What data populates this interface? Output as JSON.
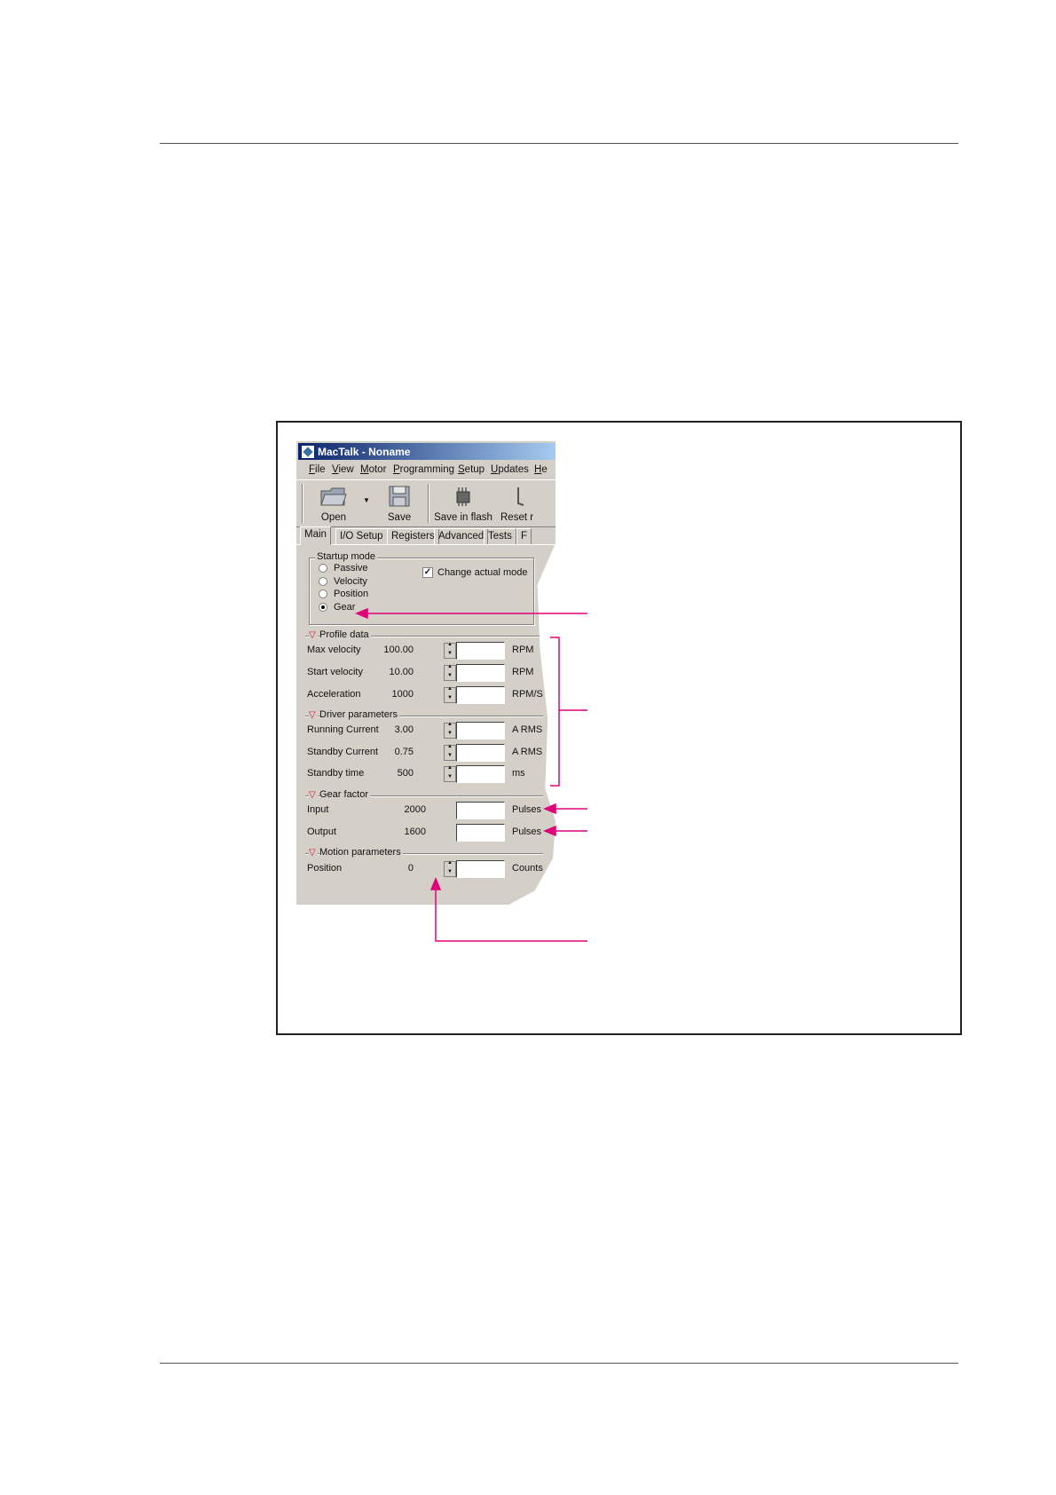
{
  "window": {
    "title": "MacTalk - Noname"
  },
  "menu": [
    "File",
    "View",
    "Motor",
    "Programming",
    "Setup",
    "Updates",
    "He"
  ],
  "toolbar": {
    "open": "Open",
    "save": "Save",
    "save_flash": "Save in flash",
    "reset": "Reset r"
  },
  "tabs": [
    "Main",
    "I/O Setup",
    "Registers",
    "Advanced",
    "Tests",
    "F"
  ],
  "startup_mode": {
    "title": "Startup mode",
    "options": [
      "Passive",
      "Velocity",
      "Position",
      "Gear"
    ],
    "selected": "Gear",
    "change_actual_mode_label": "Change actual mode",
    "change_actual_mode_checked": true
  },
  "profile_data": {
    "title": "Profile data",
    "rows": [
      {
        "label": "Max velocity",
        "value": "100.00",
        "unit": "RPM"
      },
      {
        "label": "Start velocity",
        "value": "10.00",
        "unit": "RPM"
      },
      {
        "label": "Acceleration",
        "value": "1000",
        "unit": "RPM/S"
      }
    ]
  },
  "driver_parameters": {
    "title": "Driver parameters",
    "rows": [
      {
        "label": "Running Current",
        "value": "3.00",
        "unit": "A RMS"
      },
      {
        "label": "Standby Current",
        "value": "0.75",
        "unit": "A RMS"
      },
      {
        "label": "Standby time",
        "value": "500",
        "unit": "ms"
      }
    ]
  },
  "gear_factor": {
    "title": "Gear factor",
    "rows": [
      {
        "label": "Input",
        "value": "2000",
        "unit": "Pulses"
      },
      {
        "label": "Output",
        "value": "1600",
        "unit": "Pulses"
      }
    ]
  },
  "motion_parameters": {
    "title": "Motion parameters",
    "rows": [
      {
        "label": "Position",
        "value": "0",
        "unit": "Counts"
      }
    ]
  },
  "colors": {
    "annotation": "#e2007a",
    "window_bg": "#d4d0c8",
    "titlebar": "#0a246a"
  }
}
